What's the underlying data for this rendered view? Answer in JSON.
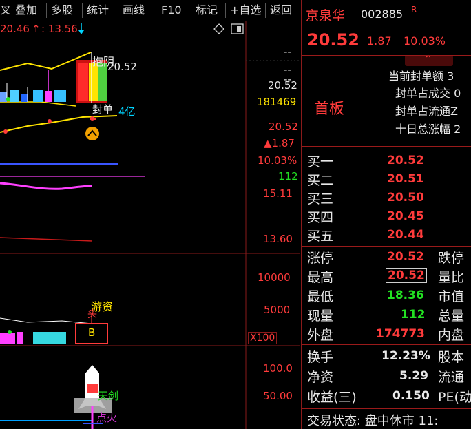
{
  "menu": [
    "叉",
    "叠加",
    "多股",
    "统计",
    "画线",
    "F10",
    "标记",
    "+自选",
    "返回"
  ],
  "chart": {
    "top_info_left": "20.46",
    "top_info_right": ": 13.56",
    "label_yinyang": "抱阴",
    "label_price_near": "20.52",
    "label_seal": "封单",
    "label_seal_amount": "4亿",
    "label_youzi": "游资",
    "label_b": "B",
    "label_tianjian": "天剑",
    "label_dianhuo": "点火"
  },
  "axis": {
    "r1": "--",
    "r2": "--",
    "r3": "--",
    "price_current": "20.52",
    "volume_now": "181469",
    "price_close": "20.52",
    "change_up": "▲1.87",
    "change_pct": "10.03%",
    "vol_small": "112",
    "high_line": "15.11",
    "low_line": "13.60",
    "vol_10000": "10000",
    "vol_5000": "5000",
    "vol_x100": "X100",
    "ind_100": "100.0",
    "ind_50": "50.00"
  },
  "stock": {
    "name": "京泉华",
    "code": "002885",
    "badge": "R",
    "price": "20.52",
    "change": "1.87",
    "change_pct": "10.03%",
    "board": "首板"
  },
  "seal_info": [
    "当前封单额 3",
    "封单占成交 0",
    "封单占流通Z",
    "十日总涨幅 2"
  ],
  "bids": [
    {
      "label": "买一",
      "price": "20.52"
    },
    {
      "label": "买二",
      "price": "20.51"
    },
    {
      "label": "买三",
      "price": "20.50"
    },
    {
      "label": "买四",
      "price": "20.45"
    },
    {
      "label": "买五",
      "price": "20.44"
    }
  ],
  "stats": [
    {
      "label": "涨停",
      "value": "20.52",
      "color": "red",
      "right": "跌停"
    },
    {
      "label": "最高",
      "value": "20.52",
      "color": "red",
      "right": "量比",
      "boxed": true
    },
    {
      "label": "最低",
      "value": "18.36",
      "color": "green",
      "right": "市值"
    },
    {
      "label": "现量",
      "value": "112",
      "color": "green",
      "right": "总量"
    },
    {
      "label": "外盘",
      "value": "174773",
      "color": "red",
      "right": "内盘"
    }
  ],
  "fundamentals": [
    {
      "label": "换手",
      "value": "12.23%",
      "right": "股本"
    },
    {
      "label": "净资",
      "value": "5.29",
      "right": "流通"
    },
    {
      "label": "收益(三)",
      "value": "0.150",
      "right": "PE(动"
    }
  ],
  "status": "交易状态: 盘中休市 11:",
  "colors": {
    "up": "#ff3b3b",
    "down": "#22e022",
    "accent": "#ffe400",
    "border": "#9a1a1a"
  }
}
